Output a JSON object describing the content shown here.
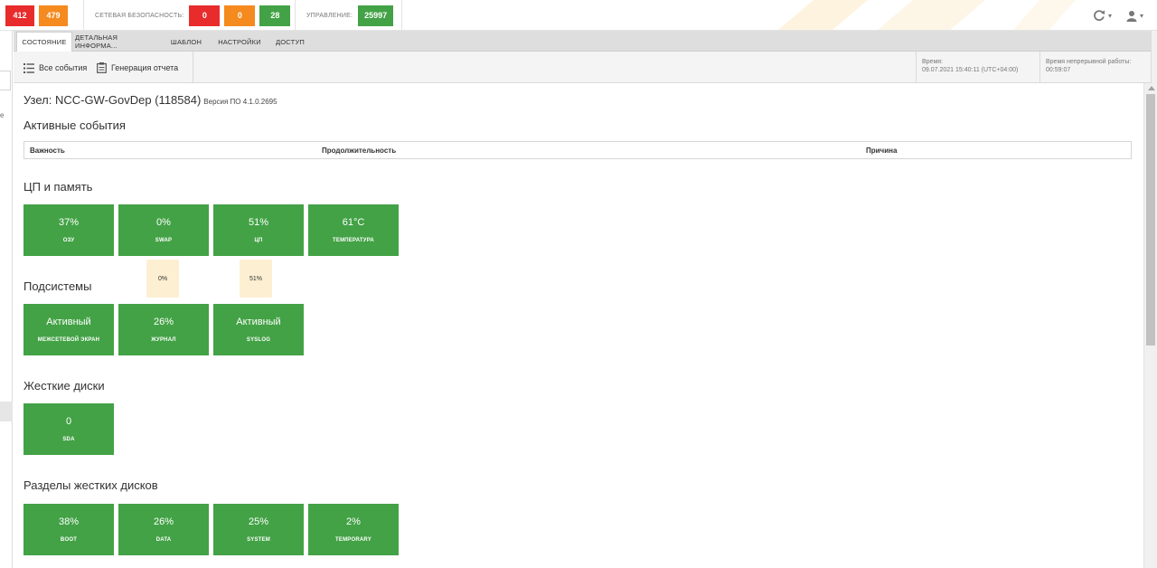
{
  "topbar": {
    "badges_left": [
      {
        "value": "412",
        "color": "#e82c2c"
      },
      {
        "value": "479",
        "color": "#f58a1f"
      }
    ],
    "network_security": {
      "label": "СЕТЕВАЯ БЕЗОПАСНОСТЬ:",
      "badges": [
        {
          "value": "0",
          "color": "#e82c2c"
        },
        {
          "value": "0",
          "color": "#f58a1f"
        },
        {
          "value": "28",
          "color": "#43a246"
        }
      ]
    },
    "management": {
      "label": "УПРАВЛЕНИЕ:",
      "value": "25997",
      "color": "#43a246"
    },
    "icons": {
      "refresh": "refresh-icon",
      "user": "user-icon",
      "caret": "▾"
    }
  },
  "tabs": [
    {
      "label": "СОСТОЯНИЕ",
      "active": true
    },
    {
      "label": "ДЕТАЛЬНАЯ ИНФОРМА...",
      "active": false
    },
    {
      "label": "ШАБЛОН",
      "active": false
    },
    {
      "label": "НАСТРОЙКИ",
      "active": false
    },
    {
      "label": "ДОСТУП",
      "active": false
    }
  ],
  "toolbar": {
    "all_events": "Все события",
    "generate_report": "Генерация отчета",
    "time_label": "Время:",
    "time_value": "09.07.2021 15:40:11 (UTC+04:00)",
    "uptime_label": "Время непрерывной работы:",
    "uptime_value": "00:59:07"
  },
  "node": {
    "heading": "Узел: NCC-GW-GovDep (118584)",
    "version": "Версия ПО 4.1.0.2695"
  },
  "active_events": {
    "title": "Активные события",
    "columns": [
      "Важность",
      "Продолжительность",
      "Причина"
    ]
  },
  "cpu_memory": {
    "title": "ЦП и память",
    "tiles": [
      {
        "value": "37%",
        "label": "ОЗУ"
      },
      {
        "value": "0%",
        "label": "SWAP"
      },
      {
        "value": "51%",
        "label": "ЦП"
      },
      {
        "value": "61°C",
        "label": "ТЕМПЕРАТУРА"
      }
    ],
    "tooltips": [
      "0%",
      "51%"
    ]
  },
  "subsystems": {
    "title": "Подсистемы",
    "tiles": [
      {
        "value": "Активный",
        "label": "МЕЖСЕТЕВОЙ ЭКРАН"
      },
      {
        "value": "26%",
        "label": "ЖУРНАЛ"
      },
      {
        "value": "Активный",
        "label": "SYSLOG"
      }
    ]
  },
  "disks": {
    "title": "Жесткие диски",
    "tiles": [
      {
        "value": "0",
        "label": "SDA"
      }
    ]
  },
  "partitions": {
    "title": "Разделы жестких дисков",
    "tiles": [
      {
        "value": "38%",
        "label": "BOOT"
      },
      {
        "value": "26%",
        "label": "DATA"
      },
      {
        "value": "25%",
        "label": "SYSTEM"
      },
      {
        "value": "2%",
        "label": "TEMPORARY"
      }
    ]
  },
  "left_strip": {
    "fragment": "е"
  },
  "colors": {
    "tile_green": "#43a246",
    "tooltip_bg": "#fcefd2",
    "tab_bar": "#dedede"
  }
}
